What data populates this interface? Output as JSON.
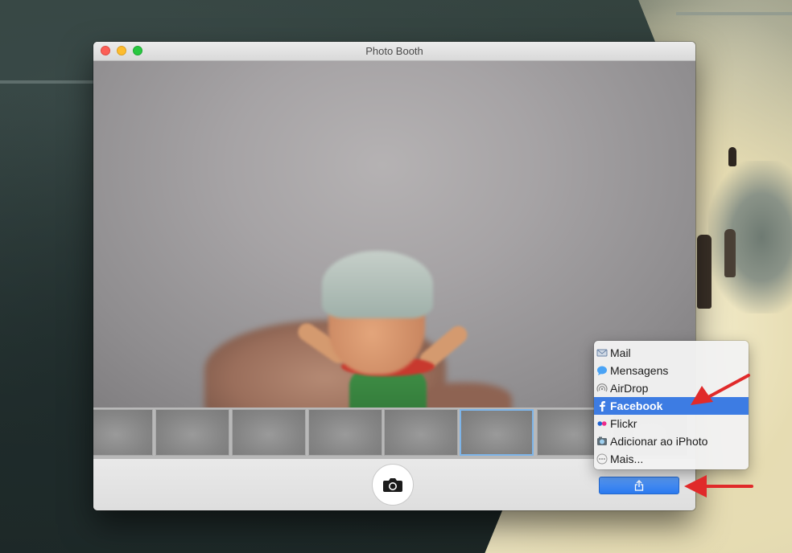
{
  "window": {
    "title": "Photo Booth"
  },
  "share_menu": {
    "items": [
      {
        "label": "Mail",
        "icon": "mail-icon",
        "highlighted": false
      },
      {
        "label": "Mensagens",
        "icon": "messages-icon",
        "highlighted": false
      },
      {
        "label": "AirDrop",
        "icon": "airdrop-icon",
        "highlighted": false
      },
      {
        "label": "Facebook",
        "icon": "facebook-icon",
        "highlighted": true
      },
      {
        "label": "Flickr",
        "icon": "flickr-icon",
        "highlighted": false
      },
      {
        "label": "Adicionar ao iPhoto",
        "icon": "iphoto-icon",
        "highlighted": false
      },
      {
        "label": "Mais...",
        "icon": "more-icon",
        "highlighted": false
      }
    ]
  },
  "toolbar": {
    "shutter_icon": "camera-icon",
    "share_icon": "share-icon"
  },
  "colors": {
    "highlight": "#3d7ce3",
    "share_button": "#2a79ee",
    "annotation_arrow": "#e02a2a",
    "selected_thumbnail": "#7db4e8"
  }
}
